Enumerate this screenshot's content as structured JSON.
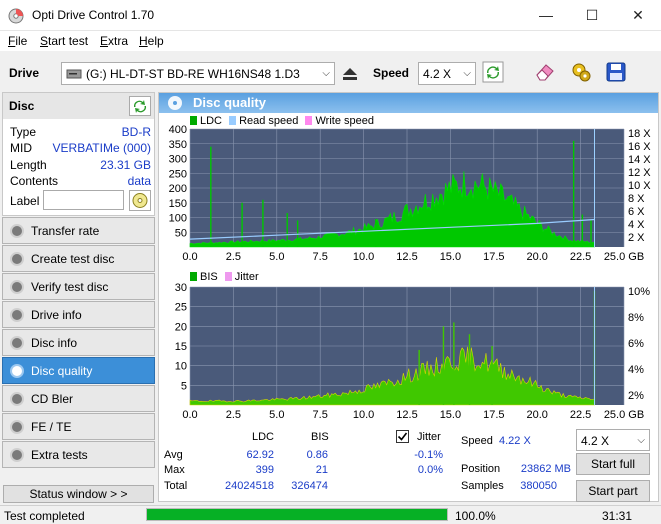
{
  "window": {
    "title": "Opti Drive Control 1.70",
    "minimize": "—",
    "maximize": "☐",
    "close": "✕"
  },
  "menu": [
    {
      "label": "File",
      "accel": "F",
      "rest": "ile"
    },
    {
      "label": "Start test",
      "accel": "S",
      "rest": "tart test"
    },
    {
      "label": "Extra",
      "accel": "E",
      "rest": "xtra"
    },
    {
      "label": "Help",
      "accel": "H",
      "rest": "elp"
    }
  ],
  "toolbar": {
    "drive_label": "Drive",
    "drive_value": "(G:)  HL-DT-ST BD-RE  WH16NS48 1.D3",
    "speed_label": "Speed",
    "speed_value": "4.2 X"
  },
  "disc": {
    "header": "Disc",
    "rows": [
      {
        "key": "Type",
        "value": "BD-R"
      },
      {
        "key": "MID",
        "value": "VERBATIMe (000)"
      },
      {
        "key": "Length",
        "value": "23.31 GB"
      },
      {
        "key": "Contents",
        "value": "data"
      }
    ],
    "label_key": "Label",
    "label_value": ""
  },
  "nav": [
    {
      "label": "Transfer rate",
      "active": false
    },
    {
      "label": "Create test disc",
      "active": false
    },
    {
      "label": "Verify test disc",
      "active": false
    },
    {
      "label": "Drive info",
      "active": false
    },
    {
      "label": "Disc info",
      "active": false
    },
    {
      "label": "Disc quality",
      "active": true
    },
    {
      "label": "CD Bler",
      "active": false
    },
    {
      "label": "FE / TE",
      "active": false
    },
    {
      "label": "Extra tests",
      "active": false
    }
  ],
  "status_window_button": "Status window > >",
  "main": {
    "title": "Disc quality",
    "legend_top": [
      "LDC",
      "Read speed",
      "Write speed"
    ],
    "legend_bottom": [
      "BIS",
      "Jitter"
    ],
    "jitter_label": "Jitter",
    "stats": {
      "headers": [
        "LDC",
        "BIS"
      ],
      "rows": [
        {
          "label": "Avg",
          "ldc": "62.92",
          "bis": "0.86",
          "jitter": "-0.1%"
        },
        {
          "label": "Max",
          "ldc": "399",
          "bis": "21",
          "jitter": "0.0%"
        },
        {
          "label": "Total",
          "ldc": "24024518",
          "bis": "326474",
          "jitter": ""
        }
      ]
    },
    "info": {
      "speed_label": "Speed",
      "speed_value": "4.22 X",
      "position_label": "Position",
      "position_value": "23862 MB",
      "samples_label": "Samples",
      "samples_value": "380050"
    },
    "speed_select": "4.2 X",
    "start_full": "Start full",
    "start_part": "Start part"
  },
  "status": {
    "text": "Test completed",
    "progress_text": "100.0%",
    "progress": 1.0,
    "time": "31:31"
  },
  "colors": {
    "ldc": "#00cc00",
    "read_speed": "#99ccff",
    "write_speed": "#ff88ee",
    "bis": "#00cc00",
    "jitter": "#ee99ee",
    "accent": "#3c8fd8",
    "plot_bg": "#4a5a7a"
  },
  "chart_data": [
    {
      "type": "area",
      "name": "LDC",
      "x_ticks": [
        "0.0",
        "2.5",
        "5.0",
        "7.5",
        "10.0",
        "12.5",
        "15.0",
        "17.5",
        "20.0",
        "22.5",
        "25.0 GB"
      ],
      "y_ticks_left": [
        "400",
        "350",
        "300",
        "250",
        "200",
        "150",
        "100",
        "50"
      ],
      "y_ticks_right": [
        "18 X",
        "16 X",
        "14 X",
        "12 X",
        "10 X",
        "8 X",
        "6 X",
        "4 X",
        "2 X"
      ],
      "xlim": [
        0,
        25
      ],
      "ylim": [
        0,
        400
      ],
      "series": [
        {
          "name": "LDC",
          "x": [
            0,
            1,
            2,
            3,
            4,
            5,
            6,
            7,
            8,
            9,
            10,
            11,
            12,
            13,
            14,
            15,
            16,
            17,
            18,
            19,
            20,
            21,
            22,
            23.3
          ],
          "values": [
            12,
            14,
            16,
            18,
            20,
            22,
            25,
            30,
            38,
            48,
            62,
            82,
            108,
            140,
            170,
            200,
            220,
            205,
            170,
            125,
            80,
            45,
            22,
            15
          ]
        },
        {
          "name": "Read speed",
          "x": [
            0,
            5,
            10,
            15,
            20,
            23.3
          ],
          "values": [
            1.2,
            1.8,
            2.4,
            3.0,
            3.6,
            4.2
          ]
        }
      ]
    },
    {
      "type": "area",
      "name": "BIS",
      "x_ticks": [
        "0.0",
        "2.5",
        "5.0",
        "7.5",
        "10.0",
        "12.5",
        "15.0",
        "17.5",
        "20.0",
        "22.5",
        "25.0 GB"
      ],
      "y_ticks_left": [
        "30",
        "25",
        "20",
        "15",
        "10",
        "5"
      ],
      "y_ticks_right": [
        "10%",
        "8%",
        "6%",
        "4%",
        "2%"
      ],
      "xlim": [
        0,
        25
      ],
      "ylim": [
        0,
        30
      ],
      "series": [
        {
          "name": "BIS",
          "x": [
            0,
            1,
            2,
            3,
            4,
            5,
            6,
            7,
            8,
            9,
            10,
            11,
            12,
            13,
            14,
            15,
            16,
            17,
            18,
            19,
            20,
            21,
            22,
            23.3
          ],
          "values": [
            1,
            1,
            1,
            1,
            1.2,
            1.4,
            1.6,
            2,
            2.5,
            3,
            4,
            5,
            6.5,
            8,
            9.5,
            11,
            12,
            11,
            9,
            7,
            5,
            3,
            2,
            1.5
          ]
        }
      ]
    }
  ]
}
